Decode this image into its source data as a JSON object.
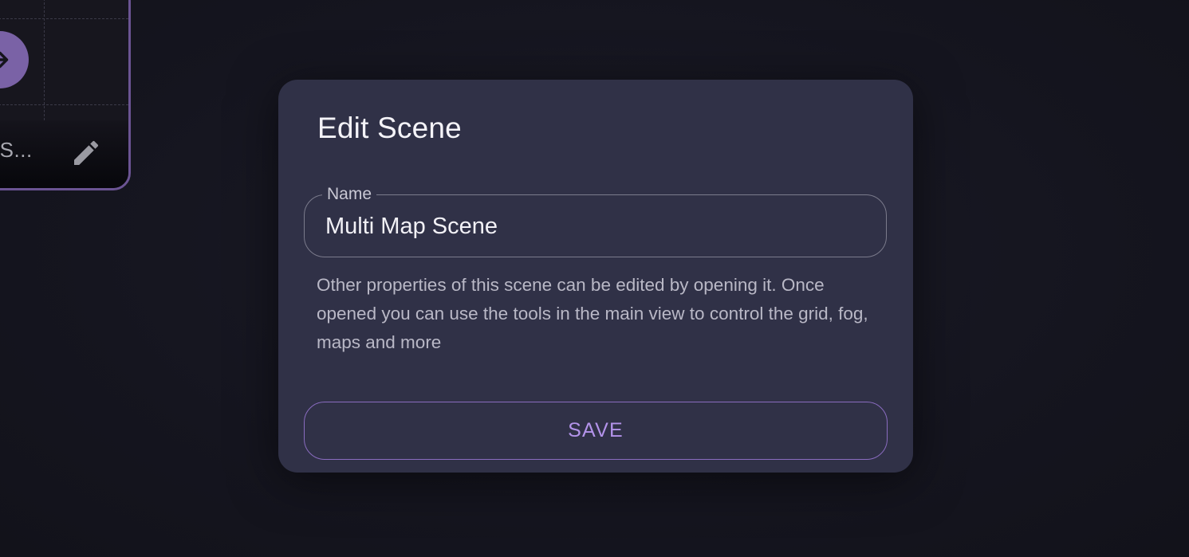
{
  "background_card": {
    "name_truncated": "p S...",
    "open_icon": "arrow-right-icon",
    "edit_icon": "pencil-icon",
    "accent_color": "#7a62a6"
  },
  "dialog": {
    "title": "Edit Scene",
    "name_field": {
      "label": "Name",
      "value": "Multi Map Scene"
    },
    "helper_text": "Other properties of this scene can be edited by opening it. Once opened you can use the tools in the main view to control the grid, fog, maps and more",
    "save_label": "SAVE",
    "accent_color": "#b393ea"
  }
}
